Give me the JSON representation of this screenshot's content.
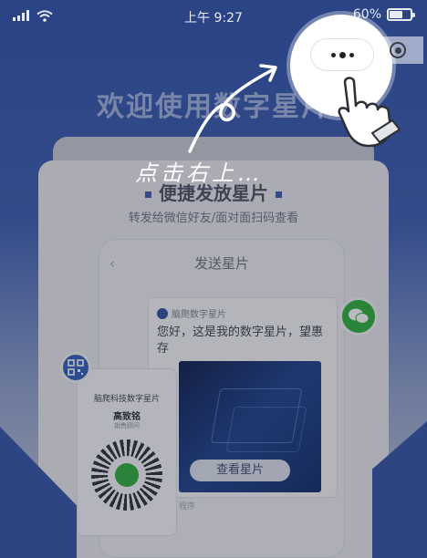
{
  "status_bar": {
    "time": "上午 9:27",
    "battery": "60%",
    "battery_level": 0.6
  },
  "hero": {
    "title": "欢迎使用数字星片"
  },
  "card": {
    "heading": "便捷发放星片",
    "subtitle": "转发给微信好友/面对面扫码查看"
  },
  "phone": {
    "nav_title": "发送星片",
    "back_glyph": "‹",
    "share": {
      "app_name": "脑爬数字星片",
      "message": "您好，这是我的数字星片，望惠存",
      "button": "查看星片",
      "footer": "程序"
    }
  },
  "mini_card": {
    "company": "脑爬科技数字星片",
    "name": "高致铭",
    "role": "销售顾问"
  },
  "hint": {
    "text": "点击右上…"
  },
  "icons": {
    "signal": "signal-icon",
    "wifi": "wifi-icon",
    "battery": "battery-icon",
    "more": "more-dots-icon",
    "close": "close-capsule-icon",
    "hand": "tap-hand-icon",
    "wechat": "wechat-icon",
    "qr": "qr-code-icon"
  },
  "colors": {
    "brand_blue": "#2f4d9f",
    "wechat_green": "#2aae3a",
    "overlay": "#282c3c"
  }
}
